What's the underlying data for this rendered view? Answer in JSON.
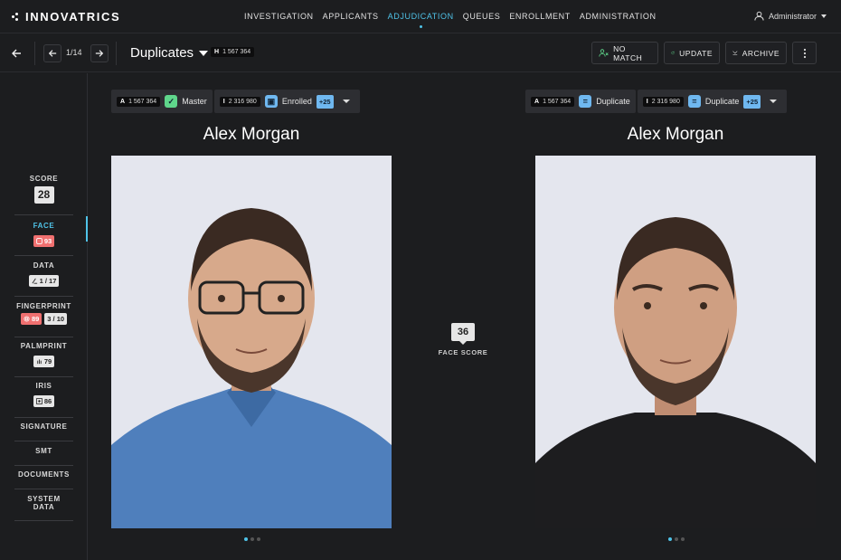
{
  "app": {
    "logo": "INNOVATRICS"
  },
  "nav": {
    "items": [
      "INVESTIGATION",
      "APPLICANTS",
      "ADJUDICATION",
      "QUEUES",
      "ENROLLMENT",
      "ADMINISTRATION"
    ],
    "active": "ADJUDICATION",
    "user": "Administrator"
  },
  "toolbar": {
    "pager": "1/14",
    "title": "Duplicates",
    "id_prefix": "H",
    "id": "1 567 364",
    "no_match": "NO MATCH",
    "update": "UPDATE",
    "archive": "ARCHIVE"
  },
  "sidebar": {
    "score_label": "SCORE",
    "score_value": "28",
    "face_label": "FACE",
    "face_value": "93",
    "data_label": "DATA",
    "data_value": "1 / 17",
    "fingerprint_label": "FINGERPRINT",
    "fingerprint_value": "89",
    "fingerprint_count": "3 / 10",
    "palmprint_label": "PALMPRINT",
    "palmprint_value": "79",
    "iris_label": "IRIS",
    "iris_value": "86",
    "signature_label": "SIGNATURE",
    "smt_label": "SMT",
    "documents_label": "DOCUMENTS",
    "system_data_label_1": "SYSTEM",
    "system_data_label_2": "DATA"
  },
  "left": {
    "rec1_prefix": "A",
    "rec1_id": "1 567 364",
    "rec1_status": "Master",
    "rec2_prefix": "I",
    "rec2_id": "2 316 980",
    "rec2_status": "Enrolled",
    "plus": "+25",
    "name": "Alex Morgan"
  },
  "right": {
    "rec1_prefix": "A",
    "rec1_id": "1 567 364",
    "rec1_status": "Duplicate",
    "rec2_prefix": "I",
    "rec2_id": "2 316 980",
    "rec2_status": "Duplicate",
    "plus": "+25",
    "name": "Alex Morgan"
  },
  "face_score": {
    "value": "36",
    "label": "FACE SCORE"
  },
  "colors": {
    "accent": "#4fc3e8",
    "master": "#5fd68b",
    "duplicate": "#6fb8f0",
    "alert": "#f07070"
  }
}
